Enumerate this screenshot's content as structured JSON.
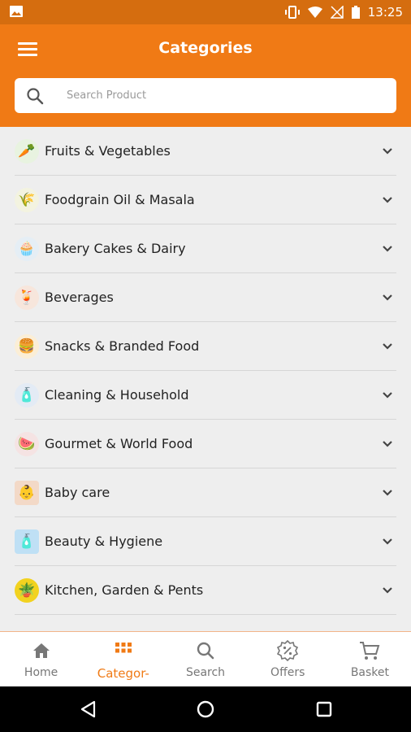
{
  "status_bar": {
    "time": "13:25"
  },
  "header": {
    "title": "Categories",
    "search_placeholder": "Search Product"
  },
  "categories": [
    {
      "label": "Fruits & Vegetables",
      "icon": "fruits-vegetables-icon"
    },
    {
      "label": "Foodgrain Oil & Masala",
      "icon": "foodgrain-icon"
    },
    {
      "label": "Bakery Cakes & Dairy",
      "icon": "bakery-icon"
    },
    {
      "label": "Beverages",
      "icon": "beverages-icon"
    },
    {
      "label": "Snacks & Branded Food",
      "icon": "snacks-icon"
    },
    {
      "label": "Cleaning & Household",
      "icon": "cleaning-icon"
    },
    {
      "label": "Gourmet & World Food",
      "icon": "gourmet-icon"
    },
    {
      "label": "Baby care",
      "icon": "baby-care-icon"
    },
    {
      "label": "Beauty & Hygiene",
      "icon": "beauty-icon"
    },
    {
      "label": "Kitchen, Garden & Pents",
      "icon": "kitchen-garden-icon"
    }
  ],
  "bottom_nav": [
    {
      "label": "Home",
      "icon": "home-icon",
      "active": false
    },
    {
      "label": "Categor-",
      "icon": "grid-icon",
      "active": true
    },
    {
      "label": "Search",
      "icon": "search-icon",
      "active": false
    },
    {
      "label": "Offers",
      "icon": "offers-icon",
      "active": false
    },
    {
      "label": "Basket",
      "icon": "basket-icon",
      "active": false
    }
  ],
  "colors": {
    "primary": "#f07a15",
    "status_bar": "#d56d0f"
  }
}
